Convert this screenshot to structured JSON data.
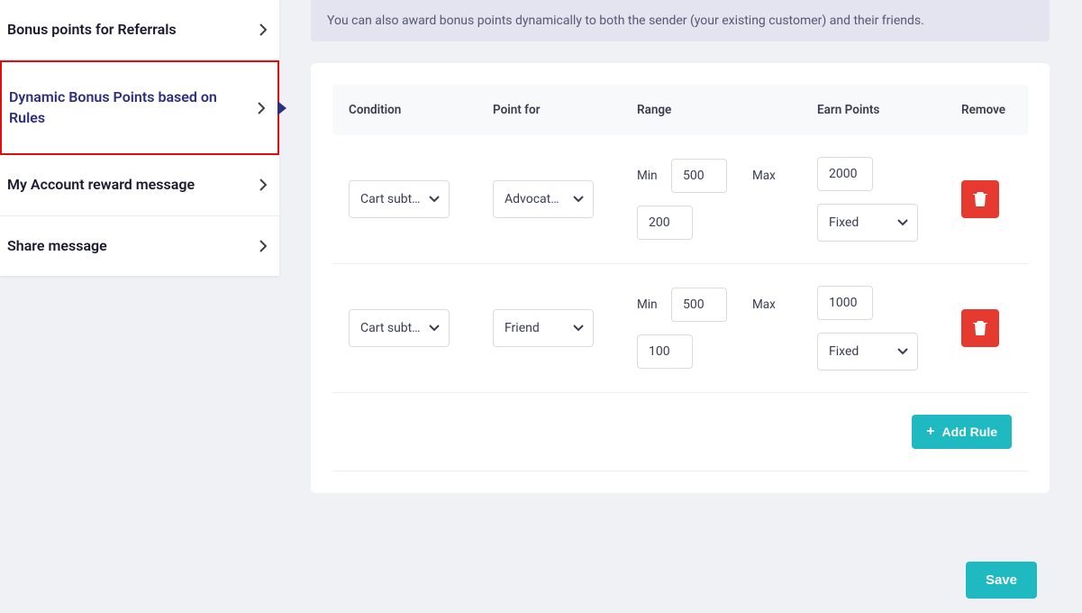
{
  "sidebar": {
    "items": [
      {
        "label": "Bonus points for Referrals",
        "active": false
      },
      {
        "label": "Dynamic Bonus Points based on Rules",
        "active": true
      },
      {
        "label": "My Account reward message",
        "active": false
      },
      {
        "label": "Share message",
        "active": false
      }
    ]
  },
  "banner": "You can also award bonus points dynamically to both the sender (your existing customer) and their friends.",
  "table": {
    "headers": {
      "condition": "Condition",
      "point_for": "Point for",
      "range": "Range",
      "earn": "Earn Points",
      "remove": "Remove"
    },
    "rows": [
      {
        "condition": "Cart subtotal",
        "point_for": "Advocate/...",
        "min_label": "Min",
        "min": "500",
        "max_label": "Max",
        "second": "200",
        "earn": "2000",
        "earn_type": "Fixed"
      },
      {
        "condition": "Cart subtotal",
        "point_for": "Friend",
        "min_label": "Min",
        "min": "500",
        "max_label": "Max",
        "second": "100",
        "earn": "1000",
        "earn_type": "Fixed"
      }
    ]
  },
  "buttons": {
    "add_rule": "Add Rule",
    "save": "Save"
  }
}
